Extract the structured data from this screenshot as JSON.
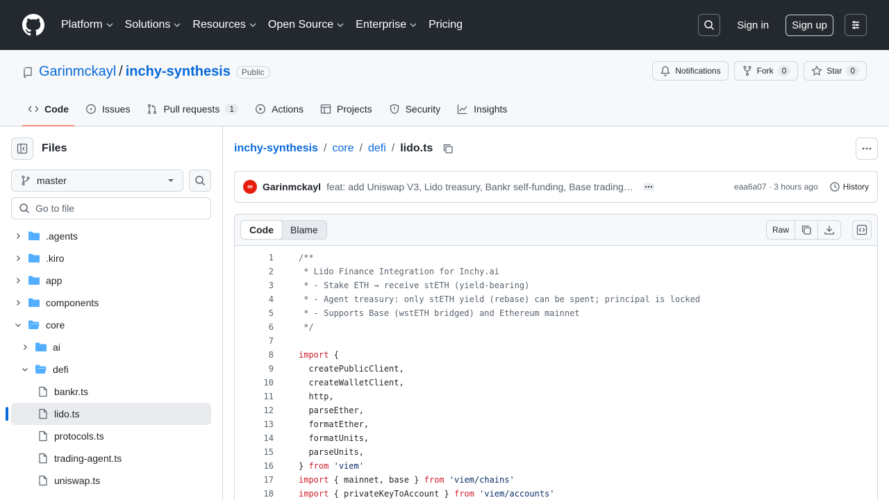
{
  "nav": {
    "items": [
      "Platform",
      "Solutions",
      "Resources",
      "Open Source",
      "Enterprise",
      "Pricing"
    ],
    "signin": "Sign in",
    "signup": "Sign up"
  },
  "repo": {
    "owner": "Garinmckayl",
    "name": "inchy-synthesis",
    "visibility": "Public",
    "notifications": "Notifications",
    "fork_label": "Fork",
    "fork_count": "0",
    "star_label": "Star",
    "star_count": "0"
  },
  "tabs": [
    {
      "label": "Code"
    },
    {
      "label": "Issues"
    },
    {
      "label": "Pull requests",
      "count": "1"
    },
    {
      "label": "Actions"
    },
    {
      "label": "Projects"
    },
    {
      "label": "Security"
    },
    {
      "label": "Insights"
    }
  ],
  "sidebar": {
    "title": "Files",
    "branch": "master",
    "goto_placeholder": "Go to file",
    "tree": [
      {
        "name": ".agents",
        "type": "dir",
        "depth": 0,
        "open": false
      },
      {
        "name": ".kiro",
        "type": "dir",
        "depth": 0,
        "open": false
      },
      {
        "name": "app",
        "type": "dir",
        "depth": 0,
        "open": false
      },
      {
        "name": "components",
        "type": "dir",
        "depth": 0,
        "open": false
      },
      {
        "name": "core",
        "type": "dir",
        "depth": 0,
        "open": true
      },
      {
        "name": "ai",
        "type": "dir",
        "depth": 1,
        "open": false
      },
      {
        "name": "defi",
        "type": "dir",
        "depth": 1,
        "open": true
      },
      {
        "name": "bankr.ts",
        "type": "file",
        "depth": 2
      },
      {
        "name": "lido.ts",
        "type": "file",
        "depth": 2,
        "selected": true
      },
      {
        "name": "protocols.ts",
        "type": "file",
        "depth": 2
      },
      {
        "name": "trading-agent.ts",
        "type": "file",
        "depth": 2
      },
      {
        "name": "uniswap.ts",
        "type": "file",
        "depth": 2
      }
    ]
  },
  "breadcrumb": {
    "repo": "inchy-synthesis",
    "p1": "core",
    "p2": "defi",
    "file": "lido.ts"
  },
  "commit": {
    "author": "Garinmckayl",
    "message": "feat: add Uniswap V3, Lido treasury, Bankr self-funding, Base trading…",
    "meta": "eaa6a07 · 3 hours ago",
    "history": "History"
  },
  "file": {
    "code_tab": "Code",
    "blame_tab": "Blame",
    "raw": "Raw",
    "lines": [
      [
        {
          "t": "/**",
          "c": "com"
        }
      ],
      [
        {
          "t": " * Lido Finance Integration for Inchy.ai",
          "c": "com"
        }
      ],
      [
        {
          "t": " * - Stake ETH → receive stETH (yield-bearing)",
          "c": "com"
        }
      ],
      [
        {
          "t": " * - Agent treasury: only stETH yield (rebase) can be spent; principal is locked",
          "c": "com"
        }
      ],
      [
        {
          "t": " * - Supports Base (wstETH bridged) and Ethereum mainnet",
          "c": "com"
        }
      ],
      [
        {
          "t": " */",
          "c": "com"
        }
      ],
      [],
      [
        {
          "t": "import",
          "c": "kw"
        },
        {
          "t": " {"
        }
      ],
      [
        {
          "t": "  createPublicClient,"
        }
      ],
      [
        {
          "t": "  createWalletClient,"
        }
      ],
      [
        {
          "t": "  http,"
        }
      ],
      [
        {
          "t": "  parseEther,"
        }
      ],
      [
        {
          "t": "  formatEther,"
        }
      ],
      [
        {
          "t": "  formatUnits,"
        }
      ],
      [
        {
          "t": "  parseUnits,"
        }
      ],
      [
        {
          "t": "} "
        },
        {
          "t": "from",
          "c": "kw"
        },
        {
          "t": " "
        },
        {
          "t": "'viem'",
          "c": "str"
        }
      ],
      [
        {
          "t": "import",
          "c": "kw"
        },
        {
          "t": " { mainnet, base } "
        },
        {
          "t": "from",
          "c": "kw"
        },
        {
          "t": " "
        },
        {
          "t": "'viem/chains'",
          "c": "str"
        }
      ],
      [
        {
          "t": "import",
          "c": "kw"
        },
        {
          "t": " { privateKeyToAccount } "
        },
        {
          "t": "from",
          "c": "kw"
        },
        {
          "t": " "
        },
        {
          "t": "'viem/accounts'",
          "c": "str"
        }
      ]
    ]
  },
  "colors": {
    "header_bg": "#24292f",
    "link": "#0969da",
    "tab_underline": "#fd8c73",
    "folder": "#54aeff",
    "keyword": "#cf222e",
    "string": "#0a3069",
    "comment": "#59636e"
  }
}
